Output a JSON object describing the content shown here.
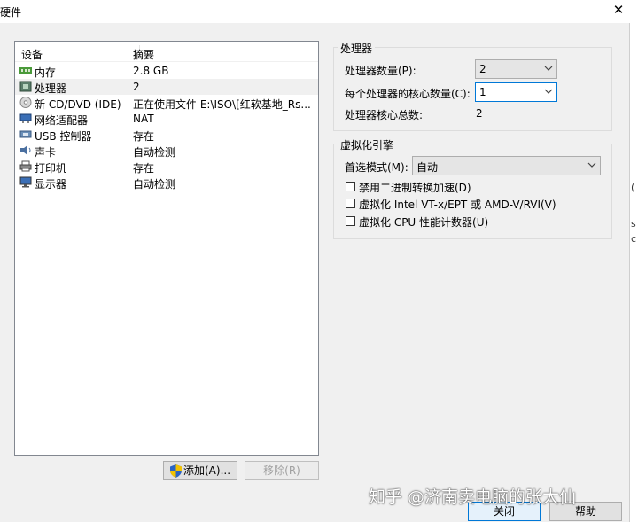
{
  "window": {
    "title": "硬件",
    "close_glyph": "✕"
  },
  "device_table": {
    "headers": {
      "device": "设备",
      "summary": "摘要"
    },
    "rows": [
      {
        "name": "内存",
        "summary": "2.8 GB",
        "icon": "memory-icon"
      },
      {
        "name": "处理器",
        "summary": "2",
        "icon": "processor-icon",
        "selected": true
      },
      {
        "name": "新 CD/DVD (IDE)",
        "summary": "正在使用文件 E:\\ISO\\[红软基地_Rs...",
        "icon": "cd-dvd-icon"
      },
      {
        "name": "网络适配器",
        "summary": "NAT",
        "icon": "network-adapter-icon"
      },
      {
        "name": "USB 控制器",
        "summary": "存在",
        "icon": "usb-icon"
      },
      {
        "name": "声卡",
        "summary": "自动检测",
        "icon": "sound-card-icon"
      },
      {
        "name": "打印机",
        "summary": "存在",
        "icon": "printer-icon"
      },
      {
        "name": "显示器",
        "summary": "自动检测",
        "icon": "display-icon"
      }
    ]
  },
  "buttons": {
    "add": "添加(A)...",
    "remove": "移除(R)",
    "close": "关闭",
    "help": "帮助"
  },
  "processor": {
    "group_title": "处理器",
    "count_label": "处理器数量(P):",
    "count_value": "2",
    "cores_label": "每个处理器的核心数量(C):",
    "cores_value": "1",
    "total_label": "处理器核心总数:",
    "total_value": "2"
  },
  "virtualization": {
    "group_title": "虚拟化引擎",
    "mode_label": "首选模式(M):",
    "mode_value": "自动",
    "options": [
      {
        "label": "禁用二进制转换加速(D)",
        "checked": false
      },
      {
        "label": "虚拟化 Intel VT-x/EPT 或 AMD-V/RVI(V)",
        "checked": false
      },
      {
        "label": "虚拟化 CPU 性能计数器(U)",
        "checked": false
      }
    ]
  },
  "watermark": "知乎 @济南卖电脑的张大仙",
  "edge_fragments": [
    "(",
    "s",
    "c"
  ],
  "colors": {
    "focus_border": "#0078d7",
    "selected_row": "#f0f0f0"
  }
}
